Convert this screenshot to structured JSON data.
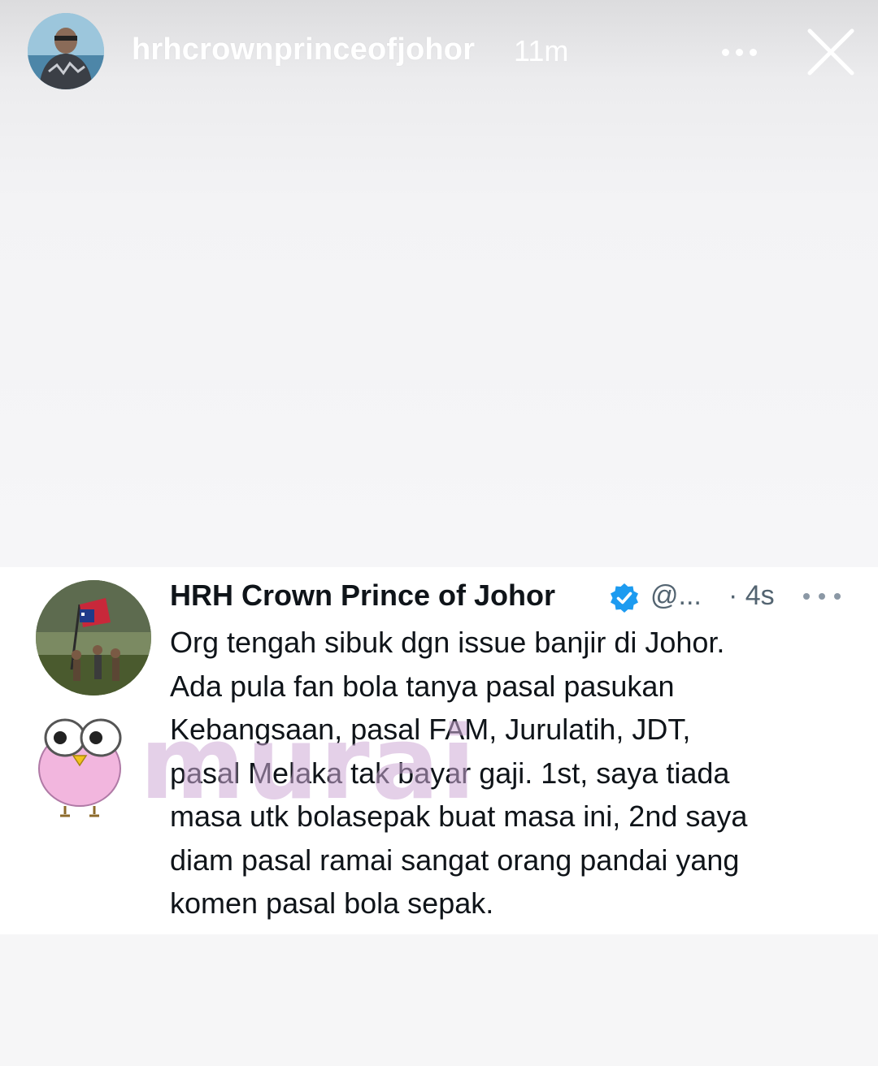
{
  "story": {
    "username": "hrhcrownprinceofjohor",
    "time": "11m",
    "icons": {
      "more": "more-horizontal-icon",
      "close": "close-icon"
    }
  },
  "tweet": {
    "name": "HRH Crown Prince of Johor",
    "handle": "@...",
    "time": "· 4s",
    "verified_color": "#1d9bf0",
    "lines": [
      "Org tengah sibuk dgn issue banjir di Johor.",
      "Ada pula fan bola tanya pasal pasukan",
      "Kebangsaan, pasal FAM, Jurulatih, JDT,",
      "pasal Melaka tak bayar gaji. 1st, saya tiada",
      "masa utk bolasepak buat masa ini, 2nd saya",
      "diam pasal ramai sangat orang pandai yang",
      "komen pasal bola sepak."
    ]
  },
  "watermark": {
    "text": "murai"
  }
}
